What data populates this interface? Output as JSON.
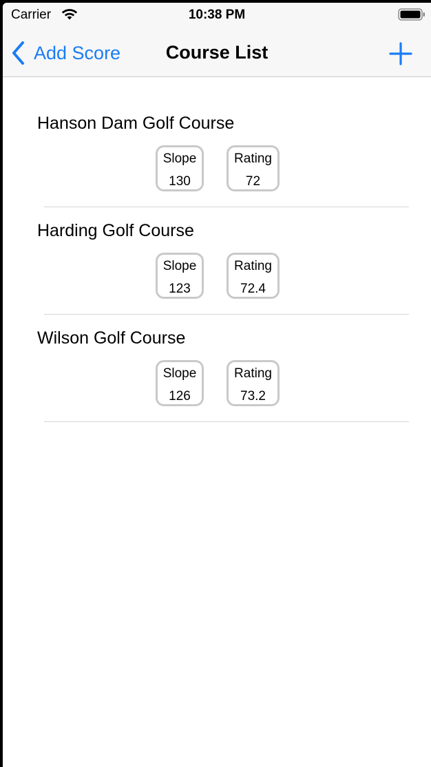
{
  "status_bar": {
    "carrier": "Carrier",
    "time": "10:38 PM",
    "wifi_icon": "wifi-icon",
    "battery_icon": "battery-icon"
  },
  "nav": {
    "back_label": "Add Score",
    "back_icon": "chevron-left-icon",
    "title": "Course List",
    "add_icon": "plus-icon"
  },
  "labels": {
    "slope": "Slope",
    "rating": "Rating"
  },
  "courses": [
    {
      "name": "Hanson Dam Golf Course",
      "slope": "130",
      "rating": "72"
    },
    {
      "name": "Harding Golf Course",
      "slope": "123",
      "rating": "72.4"
    },
    {
      "name": "Wilson Golf Course",
      "slope": "126",
      "rating": "73.2"
    }
  ],
  "colors": {
    "accent": "#1a7cf5",
    "nav_background": "#f7f7f7",
    "box_border": "#c9c9c9",
    "divider": "#d6d6d6"
  }
}
